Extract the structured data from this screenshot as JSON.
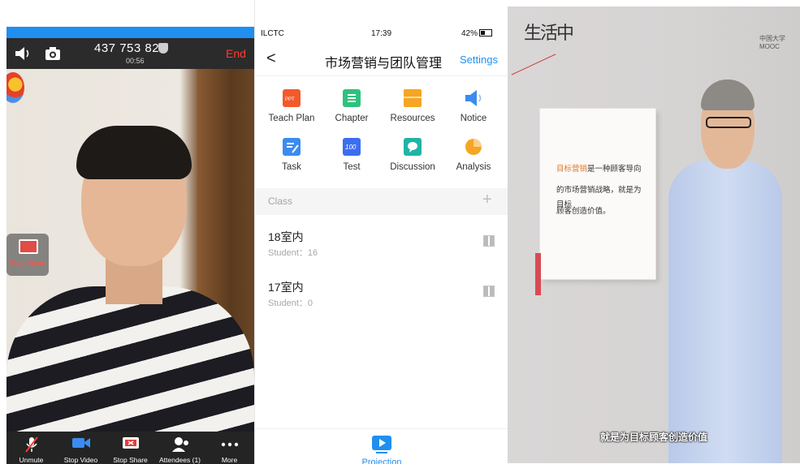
{
  "call": {
    "meeting_id": "437 753 823",
    "timer": "00:56",
    "end_label": "End",
    "stop_share_label": "Stop Share",
    "toolbar": [
      {
        "label": "Unmute",
        "icon": "mic-off-icon"
      },
      {
        "label": "Stop Video",
        "icon": "video-camera-icon"
      },
      {
        "label": "Stop Share",
        "icon": "screen-share-icon"
      },
      {
        "label": "Attendees (1)",
        "icon": "attendees-icon"
      },
      {
        "label": "More",
        "icon": "more-dots-icon"
      }
    ],
    "colors": {
      "accent": "#1f8ff0",
      "end": "#ff3b2f",
      "bar": "#242424"
    }
  },
  "app": {
    "status": {
      "carrier": "ILCTC",
      "time": "17:39",
      "battery": "42%"
    },
    "nav": {
      "back": "<",
      "title": "市场营销与团队管理",
      "settings": "Settings"
    },
    "grid": [
      {
        "label": "Teach Plan",
        "icon": "ppt-icon",
        "color": "#f25a2c"
      },
      {
        "label": "Chapter",
        "icon": "chapter-icon",
        "color": "#2ec27e"
      },
      {
        "label": "Resources",
        "icon": "folder-icon",
        "color": "#f6a524"
      },
      {
        "label": "Notice",
        "icon": "speaker-icon",
        "color": "#3b8cf0"
      },
      {
        "label": "Task",
        "icon": "task-icon",
        "color": "#3b8cf0"
      },
      {
        "label": "Test",
        "icon": "test-icon",
        "color": "#3b6ef0"
      },
      {
        "label": "Discussion",
        "icon": "discussion-icon",
        "color": "#1fb4a6"
      },
      {
        "label": "Analysis",
        "icon": "pie-chart-icon",
        "color": "#f6a524"
      }
    ],
    "class_header": "Class",
    "add": "+",
    "classes": [
      {
        "name": "18室内",
        "students": "Student：16"
      },
      {
        "name": "17室内",
        "students": "Student：0"
      }
    ],
    "bottom_label": "Projection"
  },
  "lecture": {
    "logo": "生活中",
    "mooc": "中国大学MOOC",
    "board_lines": [
      "目标营销是一种顾客导向",
      "的市场营销战略，就是为目标",
      "顾客创造价值。"
    ],
    "board_highlight": "目标营销",
    "subtitle": "就是为目标顾客创造价值"
  }
}
